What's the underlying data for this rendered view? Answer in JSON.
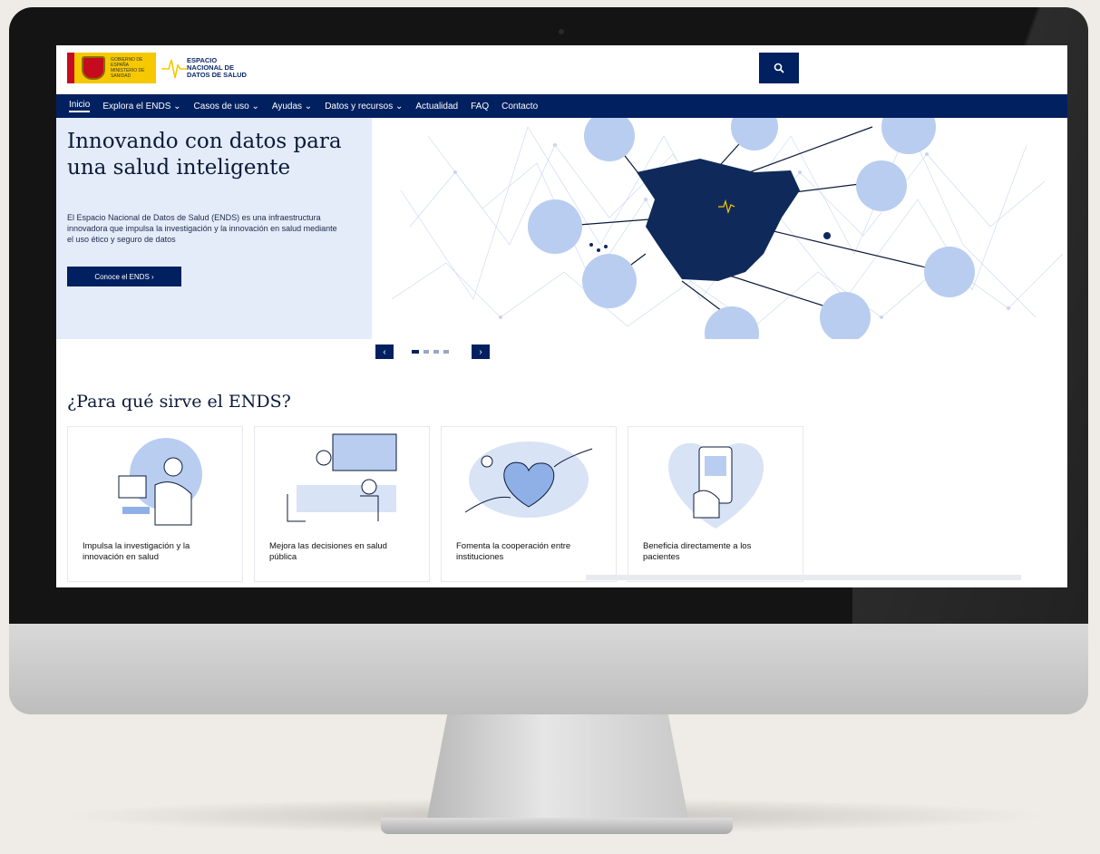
{
  "header": {
    "gov_logo_text": "GOBIERNO DE ESPAÑA MINISTERIO DE SANIDAD",
    "ends_logo_line1": "ESPACIO",
    "ends_logo_line2": "NACIONAL DE",
    "ends_logo_line3": "DATOS DE SALUD",
    "search_icon": "search-icon"
  },
  "nav": {
    "items": [
      "Inicio",
      "Explora el ENDS ⌄",
      "Casos de uso ⌄",
      "Ayudas ⌄",
      "Datos y recursos ⌄",
      "Actualidad",
      "FAQ",
      "Contacto"
    ]
  },
  "hero": {
    "title": "Innovando con datos para una salud inteligente",
    "description": "El Espacio Nacional de Datos de Salud (ENDS) es una infraestructura innovadora que impulsa la investigación y la innovación en salud mediante el uso ético y seguro de datos",
    "button_label": "Conoce el ENDS  ›",
    "map_label": "ESPACIO NACIONAL DE DATOS DE SALUD"
  },
  "carousel": {
    "prev_label": "‹",
    "next_label": "›",
    "slide_count": 4,
    "active_slide": 1
  },
  "section": {
    "title": "¿Para qué sirve el ENDS?"
  },
  "cards": [
    {
      "label": "Impulsa la investigación y la innovación en salud"
    },
    {
      "label": "Mejora las decisiones en salud pública"
    },
    {
      "label": "Fomenta la cooperación entre instituciones"
    },
    {
      "label": "Beneficia directamente a los pacientes"
    }
  ],
  "colors": {
    "primary": "#002060",
    "hero_bg": "#e4ecf9",
    "accent_yellow": "#f6c800",
    "illustration_blue": "#b9cdf0"
  }
}
